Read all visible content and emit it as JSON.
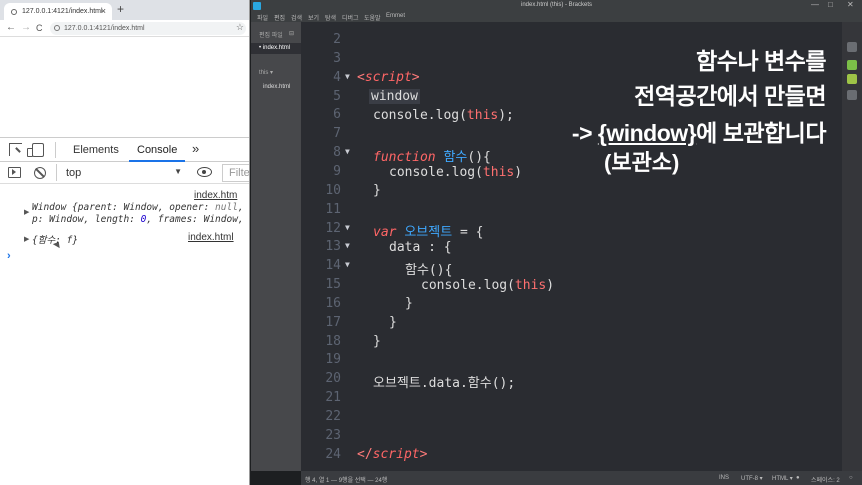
{
  "browser": {
    "tab_title": "127.0.0.1:4121/index.html",
    "tab_close": "×",
    "new_tab": "+",
    "back": "←",
    "forward": "→",
    "reload": "C",
    "url": "127.0.0.1:4121/index.html",
    "star": "☆"
  },
  "devtools": {
    "tabs": [
      "Elements",
      "Console"
    ],
    "more": "»",
    "context": "top",
    "filter_placeholder": "Filte",
    "entries": [
      {
        "source": "index.htm",
        "line1_prefix": "Window {parent: Window, opener: ",
        "line1_null": "null",
        "line1_suffix": ",",
        "line2_a": "p: Window, length: ",
        "line2_num": "0",
        "line2_b": ", frames: Window,"
      },
      {
        "source": "index.html",
        "text": "{함수: f}"
      }
    ],
    "prompt": "›"
  },
  "brackets": {
    "title": "index.html (this) - Brackets",
    "window_controls": [
      "—",
      "□",
      "✕"
    ],
    "menu": [
      "파일",
      "편집",
      "검색",
      "보기",
      "탐색",
      "디버그",
      "도움말",
      "Emmet"
    ],
    "sidebar": {
      "working_files_label": "편집 파일",
      "working_file": "index.html",
      "project_label": "this ▾",
      "project_file": "index.html"
    },
    "status": {
      "position": "행 4, 열 1 — 9행을 선택 — 24행",
      "mode": "INS",
      "encoding": "UTF-8 ▾",
      "language": "HTML ▾",
      "spaces": "스페이스: 2"
    }
  },
  "code_lines": [
    {
      "n": "2",
      "fold": ""
    },
    {
      "n": "3",
      "fold": ""
    },
    {
      "n": "4",
      "fold": "▼"
    },
    {
      "n": "5",
      "fold": ""
    },
    {
      "n": "6",
      "fold": ""
    },
    {
      "n": "7",
      "fold": ""
    },
    {
      "n": "8",
      "fold": "▼"
    },
    {
      "n": "9",
      "fold": ""
    },
    {
      "n": "10",
      "fold": ""
    },
    {
      "n": "11",
      "fold": ""
    },
    {
      "n": "12",
      "fold": "▼"
    },
    {
      "n": "13",
      "fold": "▼"
    },
    {
      "n": "14",
      "fold": "▼"
    },
    {
      "n": "15",
      "fold": ""
    },
    {
      "n": "16",
      "fold": ""
    },
    {
      "n": "17",
      "fold": ""
    },
    {
      "n": "18",
      "fold": ""
    },
    {
      "n": "19",
      "fold": ""
    },
    {
      "n": "20",
      "fold": ""
    },
    {
      "n": "21",
      "fold": ""
    },
    {
      "n": "22",
      "fold": ""
    },
    {
      "n": "23",
      "fold": ""
    },
    {
      "n": "24",
      "fold": ""
    }
  ],
  "code": {
    "l4_open": "<",
    "l4_tag": "script",
    "l4_close": ">",
    "l5": "window",
    "l6_a": "console.log(",
    "l6_this": "this",
    "l6_b": ");",
    "l8_kw": "function",
    "l8_fn": "함수",
    "l8_rest": "(){",
    "l9_a": "console.log(",
    "l9_this": "this",
    "l9_b": ")",
    "l10": "}",
    "l12_kw": "var",
    "l12_name": "오브젝트",
    "l12_rest": " = {",
    "l13": "data : {",
    "l14": "함수(){",
    "l15_a": "console.log(",
    "l15_this": "this",
    "l15_b": ")",
    "l16": "}",
    "l17": "}",
    "l18": "}",
    "l20": "오브젝트.data.함수();",
    "l24_open": "</",
    "l24_tag": "script",
    "l24_close": ">"
  },
  "overlay": {
    "line1": "함수나 변수를",
    "line2": "전역공간에서 만들면",
    "line3_arrow": "->",
    "line3_window": "{window}",
    "line3_rest": "에 보관합니다",
    "line4": "(보관소)"
  }
}
